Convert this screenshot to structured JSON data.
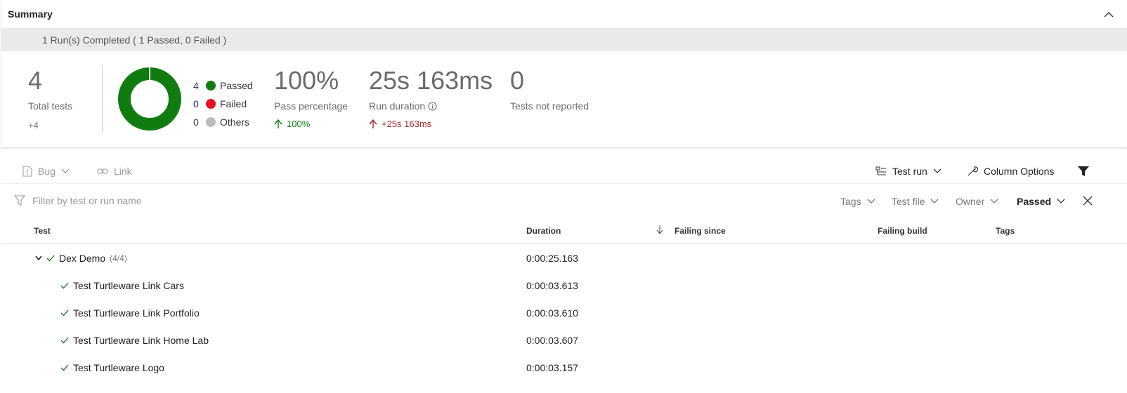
{
  "summary": {
    "title": "Summary",
    "banner": "1 Run(s) Completed ( 1 Passed, 0 Failed )",
    "total_tests": {
      "value": "4",
      "label": "Total tests",
      "delta": "+4"
    },
    "outcome": {
      "passed": 4,
      "failed": 0,
      "others": 0,
      "legend": [
        {
          "count": "4",
          "label": "Passed",
          "color": "#107c10"
        },
        {
          "count": "0",
          "label": "Failed",
          "color": "#e81123"
        },
        {
          "count": "0",
          "label": "Others",
          "color": "#bdbdbd"
        }
      ]
    },
    "pass_percentage": {
      "value": "100%",
      "label": "Pass percentage",
      "delta": "100%"
    },
    "run_duration": {
      "value": "25s 163ms",
      "label": "Run duration",
      "delta": "+25s 163ms"
    },
    "not_reported": {
      "value": "0",
      "label": "Tests not reported"
    }
  },
  "toolbar": {
    "bug_label": "Bug",
    "link_label": "Link",
    "test_run_label": "Test run",
    "column_options_label": "Column Options"
  },
  "filter": {
    "placeholder": "Filter by test or run name",
    "dropdowns": [
      "Tags",
      "Test file",
      "Owner"
    ],
    "selected_outcome": "Passed"
  },
  "table": {
    "columns": [
      "Test",
      "Duration",
      "Failing since",
      "Failing build",
      "Tags"
    ],
    "group": {
      "name": "Dex Demo",
      "count": "(4/4)",
      "duration": "0:00:25.163"
    },
    "rows": [
      {
        "name": "Test Turtleware Link Cars",
        "duration": "0:00:03.613"
      },
      {
        "name": "Test Turtleware Link Portfolio",
        "duration": "0:00:03.610"
      },
      {
        "name": "Test Turtleware Link Home Lab",
        "duration": "0:00:03.607"
      },
      {
        "name": "Test Turtleware Logo",
        "duration": "0:00:03.157"
      }
    ]
  },
  "colors": {
    "pass": "#107c10",
    "fail": "#a4262c",
    "accent": "#0078d4"
  }
}
